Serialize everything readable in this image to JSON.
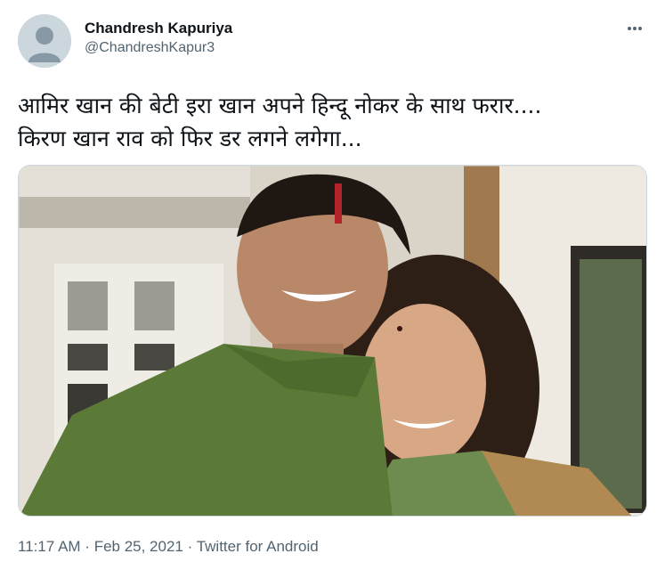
{
  "author": {
    "display_name": "Chandresh Kapuriya",
    "handle": "@ChandreshKapur3"
  },
  "tweet": {
    "lines": [
      "आमिर खान की बेटी इरा खान अपने हिन्दू नोकर के साथ फरार....",
      "किरण खान राव को फिर डर लगने लगेगा..."
    ]
  },
  "meta": {
    "time": "11:17 AM",
    "separator": " · ",
    "date": "Feb 25, 2021",
    "source": "Twitter for Android"
  },
  "icons": {
    "more": "more-horizontal-icon",
    "avatar": "default-avatar-icon"
  },
  "colors": {
    "text_primary": "#0f1419",
    "text_secondary": "#536471",
    "border": "#cfd9de"
  }
}
